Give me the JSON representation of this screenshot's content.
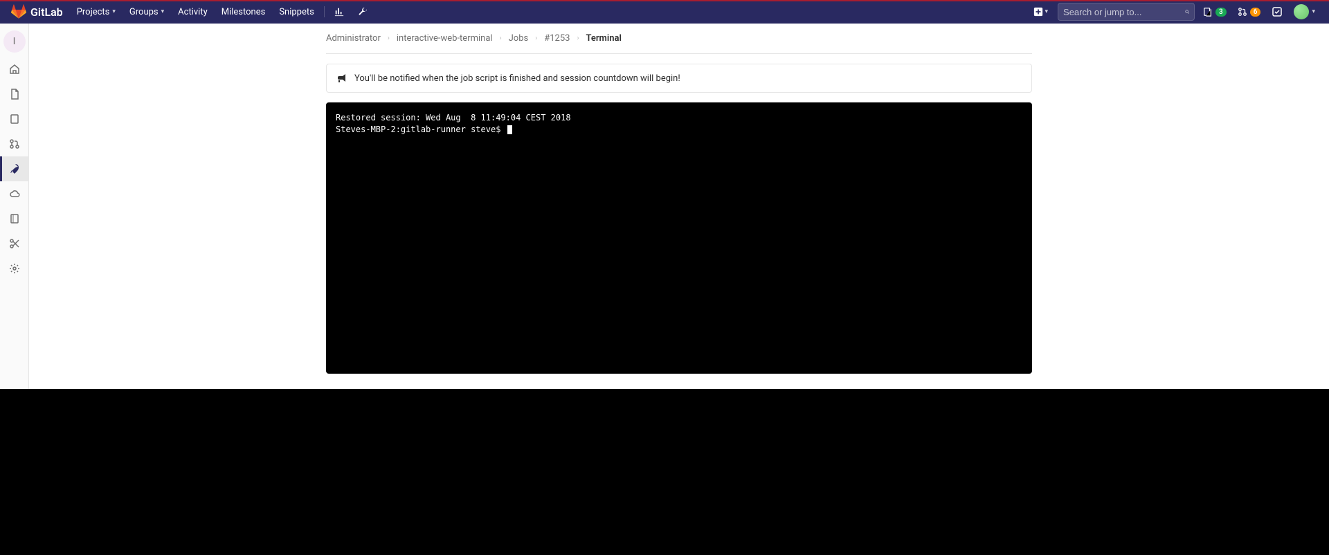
{
  "brand": "GitLab",
  "nav": {
    "projects": "Projects",
    "groups": "Groups",
    "activity": "Activity",
    "milestones": "Milestones",
    "snippets": "Snippets"
  },
  "search": {
    "placeholder": "Search or jump to..."
  },
  "badges": {
    "issues": "3",
    "mrs": "6"
  },
  "project_initial": "I",
  "breadcrumbs": {
    "b0": "Administrator",
    "b1": "interactive-web-terminal",
    "b2": "Jobs",
    "b3": "#1253",
    "current": "Terminal"
  },
  "notice": "You'll be notified when the job script is finished and session countdown will begin!",
  "terminal": {
    "line1": "Restored session: Wed Aug  8 11:49:04 CEST 2018",
    "prompt": "Steves-MBP-2:gitlab-runner steve$ "
  }
}
